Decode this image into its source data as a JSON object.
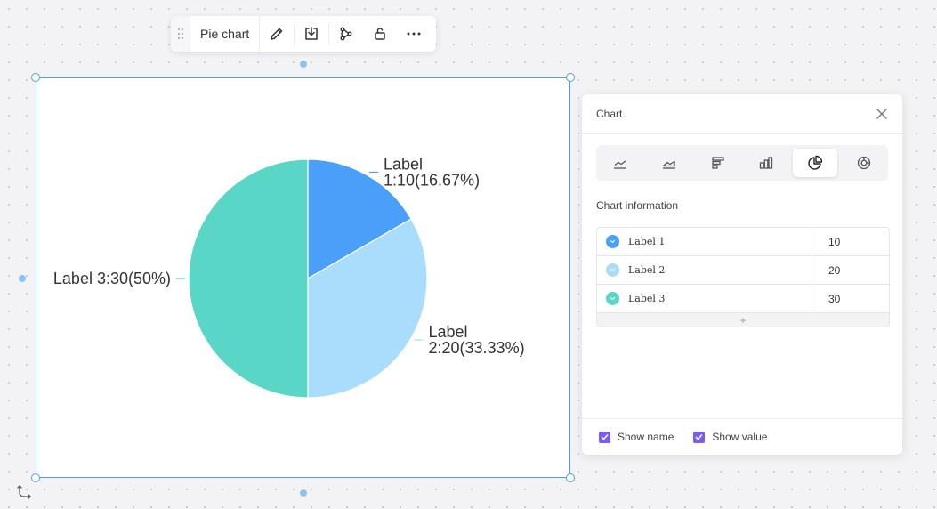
{
  "toolbar": {
    "title": "Pie chart",
    "icons": [
      "drag-handle-icon",
      "pencil-icon",
      "download-icon",
      "link-nodes-icon",
      "unlock-icon",
      "more-icon"
    ]
  },
  "chart_data": {
    "type": "pie",
    "slices": [
      {
        "name": "Label 1",
        "value": 10,
        "percent": 16.67,
        "color": "#4aa0f8",
        "label_lines": [
          "Label",
          "1:10(16.67%)"
        ]
      },
      {
        "name": "Label 2",
        "value": 20,
        "percent": 33.33,
        "color": "#a9ddfb",
        "label_lines": [
          "Label",
          "2:20(33.33%)"
        ]
      },
      {
        "name": "Label 3",
        "value": 30,
        "percent": 50,
        "color": "#5ad6c6",
        "label_lines": [
          "Label 3:30(50%)"
        ]
      }
    ],
    "show_name": true,
    "show_value": true
  },
  "panel": {
    "title": "Chart",
    "chart_types": [
      "line-chart-icon",
      "area-chart-icon",
      "horizontal-bar-icon",
      "bar-chart-icon",
      "pie-chart-icon",
      "donut-chart-icon"
    ],
    "active_type": "pie-chart-icon",
    "section_title": "Chart information",
    "rows": [
      {
        "label": "Label 1",
        "value": "10",
        "color": "#4aa0f8"
      },
      {
        "label": "Label 2",
        "value": "20",
        "color": "#a9ddfb"
      },
      {
        "label": "Label 3",
        "value": "30",
        "color": "#5ad6c6"
      }
    ],
    "add_symbol": "+",
    "show_name_label": "Show name",
    "show_value_label": "Show value",
    "checkbox_color": "#7b5cf0"
  }
}
